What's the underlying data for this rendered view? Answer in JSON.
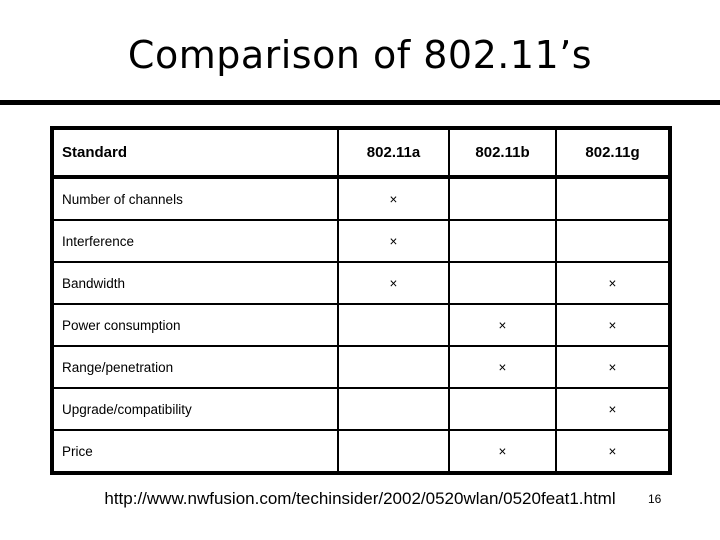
{
  "slide": {
    "title": "Comparison of 802.11’s",
    "footer_url": "http://www.nwfusion.com/techinsider/2002/0520wlan/0520feat1.html",
    "page_number": "16"
  },
  "table": {
    "columns": [
      {
        "key": "standard",
        "label": "Standard"
      },
      {
        "key": "a",
        "label": "802.11a"
      },
      {
        "key": "b",
        "label": "802.11b"
      },
      {
        "key": "g",
        "label": "802.11g"
      }
    ],
    "mark_glyph": "×",
    "rows": [
      {
        "label": "Number of channels",
        "a": "×",
        "b": "",
        "g": ""
      },
      {
        "label": "Interference",
        "a": "×",
        "b": "",
        "g": ""
      },
      {
        "label": "Bandwidth",
        "a": "×",
        "b": "",
        "g": "×"
      },
      {
        "label": "Power consumption",
        "a": "",
        "b": "×",
        "g": "×"
      },
      {
        "label": "Range/penetration",
        "a": "",
        "b": "×",
        "g": "×"
      },
      {
        "label": "Upgrade/compatibility",
        "a": "",
        "b": "",
        "g": "×"
      },
      {
        "label": "Price",
        "a": "",
        "b": "×",
        "g": "×"
      }
    ]
  },
  "colors": {
    "text": "#000000",
    "background": "#ffffff",
    "rule": "#000000"
  }
}
